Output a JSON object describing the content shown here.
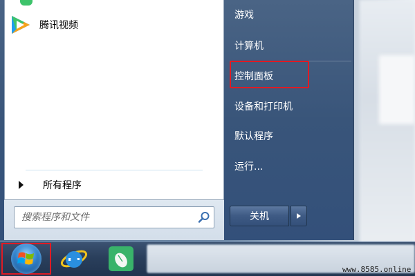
{
  "start_menu": {
    "pinned_apps": [
      {
        "label": "腾讯视频",
        "icon": "tencent-video-icon"
      }
    ],
    "all_programs_label": "所有程序",
    "search": {
      "placeholder": "搜索程序和文件",
      "value": ""
    },
    "right_items": [
      {
        "label": "游戏"
      },
      {
        "label": "计算机"
      },
      {
        "label": "控制面板",
        "highlighted": true
      },
      {
        "label": "设备和打印机"
      },
      {
        "label": "默认程序"
      },
      {
        "label": "运行..."
      }
    ],
    "shutdown_label": "关机"
  },
  "taskbar": {
    "start_button": "windows-orb-icon",
    "pinned": [
      "internet-explorer-icon",
      "app-icon-green"
    ]
  },
  "watermark": "www.8585.online",
  "colors": {
    "highlight_border": "#e01b24",
    "menu_right_bg": "#39557a",
    "tencent_green": "#3ec36b",
    "tencent_blue": "#1f9ef0"
  }
}
